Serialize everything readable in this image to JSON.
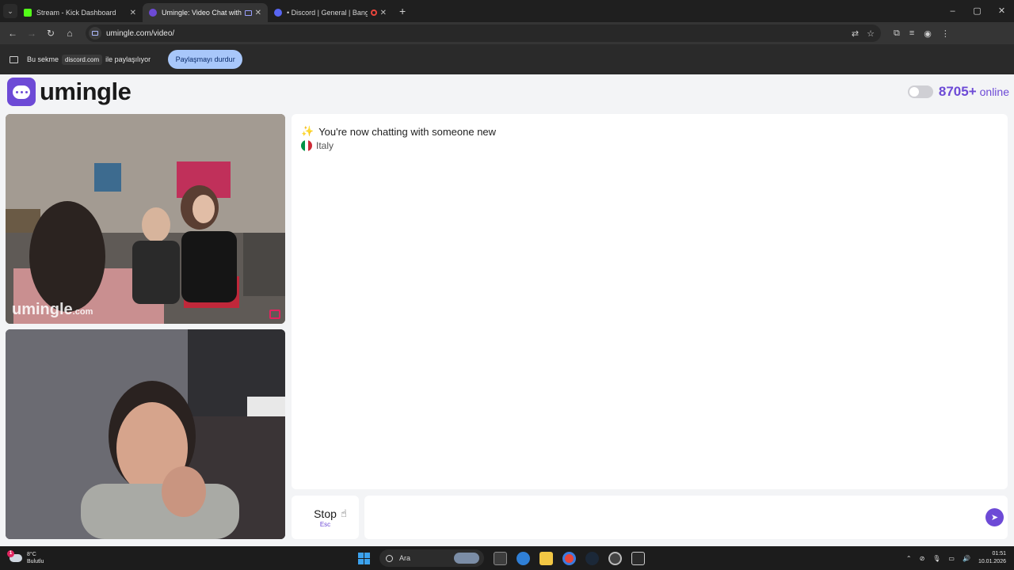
{
  "browser": {
    "tabs": [
      {
        "title": "Stream - Kick Dashboard",
        "color": "#53fc18",
        "active": false
      },
      {
        "title": "Umingle: Video Chat with S",
        "color": "#6d4ad6",
        "active": true
      },
      {
        "title": "• Discord | General | Bang",
        "color": "#5865f2",
        "active": false
      }
    ],
    "url": "umingle.com/video/",
    "window_controls": [
      "–",
      "▢",
      "✕"
    ]
  },
  "share_bar": {
    "prefix": "Bu sekme",
    "target": "discord.com",
    "suffix": "ile paylaşılıyor",
    "stop_label": "Paylaşmayı durdur"
  },
  "site": {
    "brand": "umingle",
    "online_count": "8705+",
    "online_label": "online",
    "accent": "#6d4ad6"
  },
  "video": {
    "watermark_main": "umingle",
    "watermark_suffix": ".com"
  },
  "chat": {
    "system_message": "You're now chatting with someone new",
    "country": "Italy",
    "input_placeholder": ""
  },
  "controls": {
    "stop_label": "Stop",
    "stop_shortcut": "Esc"
  },
  "taskbar": {
    "temperature": "8°C",
    "weather": "Bulutlu",
    "weather_badge": "1",
    "search_label": "Ara",
    "time": "01:51",
    "date": "10.01.2026"
  }
}
